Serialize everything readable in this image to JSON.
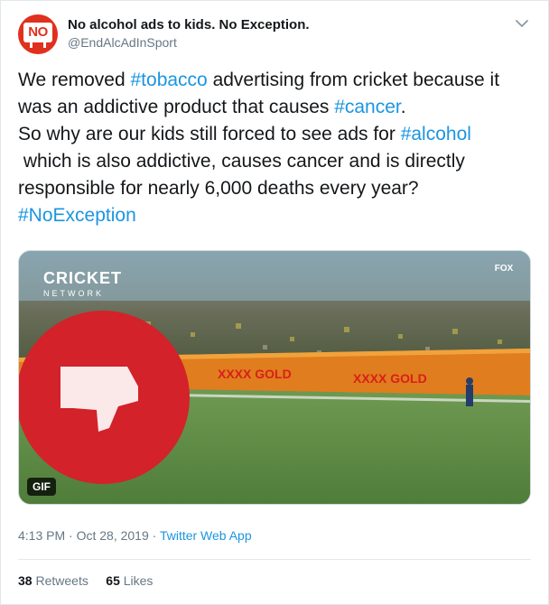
{
  "account": {
    "name": "No alcohol ads to kids. No Exception.",
    "handle": "@EndAlcAdInSport",
    "avatar_text": "NO"
  },
  "tweet": {
    "segments": [
      {
        "text": "We removed ",
        "tag": false
      },
      {
        "text": "#tobacco",
        "tag": true
      },
      {
        "text": " advertising from cricket because it was an addictive product that causes ",
        "tag": false
      },
      {
        "text": "#cancer",
        "tag": true
      },
      {
        "text": ".\nSo why are our kids still forced to see ads for ",
        "tag": false
      },
      {
        "text": "#alcohol",
        "tag": true
      },
      {
        "text": "\n which is also addictive, causes cancer and is directly responsible for nearly 6,000 deaths every year?\n",
        "tag": false
      },
      {
        "text": "#NoException",
        "tag": true
      }
    ]
  },
  "media": {
    "gif_label": "GIF",
    "channel_logo": "CRICKET",
    "channel_sub": "NETWORK",
    "broadcaster_logo": "FOX",
    "banner_text": "XXXX GOLD",
    "icon": "thumbs-down-icon"
  },
  "meta": {
    "time": "4:13 PM · Oct 28, 2019 · ",
    "app": "Twitter Web App"
  },
  "stats": {
    "retweets_count": "38",
    "retweets_label": "Retweets",
    "likes_count": "65",
    "likes_label": "Likes"
  },
  "colors": {
    "link": "#1b95e0",
    "avatar_red": "#e0301e",
    "muted": "#657786"
  }
}
